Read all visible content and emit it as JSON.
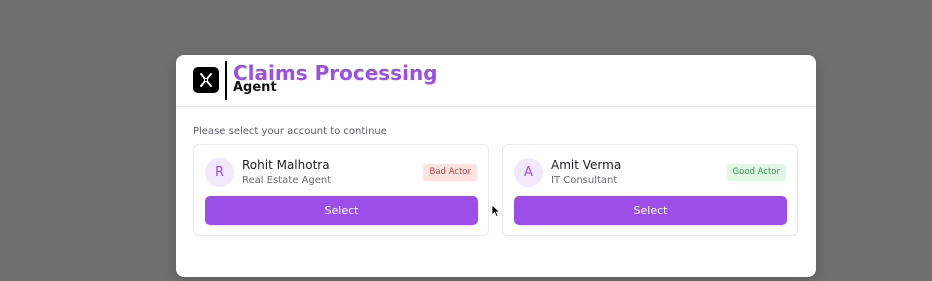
{
  "modal": {
    "brand": {
      "title": "Claims Processing",
      "subtitle": "Agent",
      "logo_icon": "agent-logo-icon"
    },
    "prompt": "Please select your account to continue",
    "accounts": [
      {
        "initial": "R",
        "name": "Rohit Malhotra",
        "role": "Real Estate Agent",
        "badge": "Bad Actor",
        "badge_type": "bad",
        "button_label": "Select"
      },
      {
        "initial": "A",
        "name": "Amit Verma",
        "role": "IT Consultant",
        "badge": "Good Actor",
        "badge_type": "good",
        "button_label": "Select"
      }
    ]
  },
  "colors": {
    "accent": "#9b4ee8",
    "backdrop": "#6f6f6f",
    "bad_badge_bg": "#fde2e2",
    "bad_badge_text": "#c53b3b",
    "good_badge_bg": "#e0f6e6",
    "good_badge_text": "#2e9a50"
  }
}
